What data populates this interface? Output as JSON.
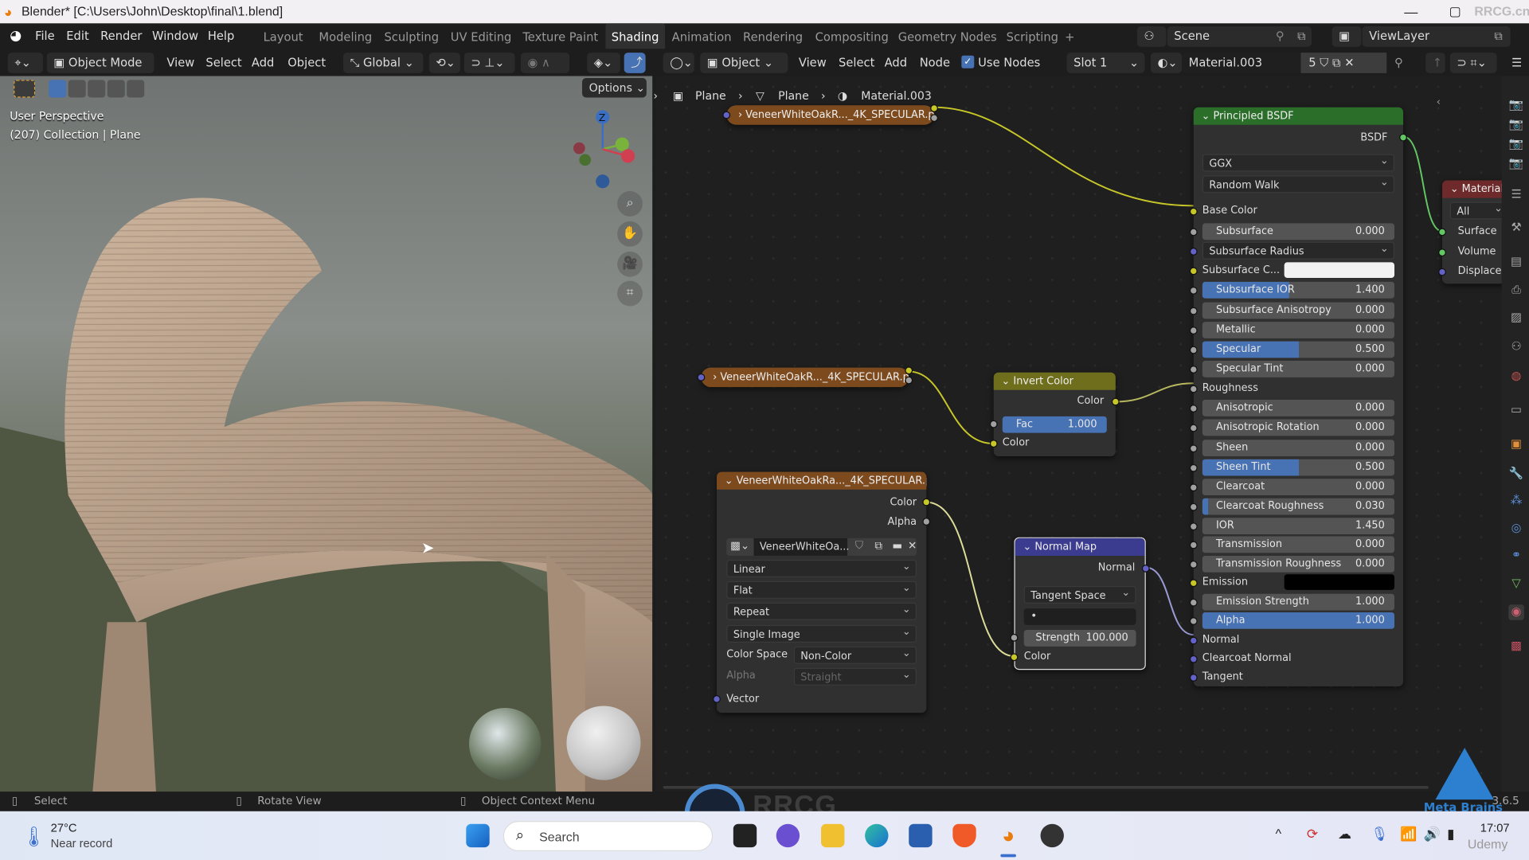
{
  "window": {
    "title": "Blender* [C:\\Users\\John\\Desktop\\final\\1.blend]",
    "watermark": "RRCG.cn"
  },
  "menu": [
    "File",
    "Edit",
    "Render",
    "Window",
    "Help"
  ],
  "workspaces": [
    "Layout",
    "Modeling",
    "Sculpting",
    "UV Editing",
    "Texture Paint",
    "Shading",
    "Animation",
    "Rendering",
    "Compositing",
    "Geometry Nodes",
    "Scripting",
    "+"
  ],
  "active_workspace": "Shading",
  "scene": {
    "name": "Scene",
    "view_layer": "ViewLayer"
  },
  "viewport_header": {
    "mode": "Object Mode",
    "items": [
      "View",
      "Select",
      "Add",
      "Object"
    ],
    "transform": "Global",
    "options": "Options"
  },
  "viewport": {
    "perspective": "User Perspective",
    "collection": "(207) Collection | Plane",
    "axes": {
      "z": "Z",
      "y": "Y",
      "x": "X"
    }
  },
  "node_header": {
    "type": "Object",
    "items": [
      "View",
      "Select",
      "Add",
      "Node"
    ],
    "use_nodes": "Use Nodes",
    "use_nodes_checked": true,
    "slot": "Slot 1",
    "material": "Material.003",
    "users": "5"
  },
  "breadcrumb": [
    "Plane",
    "Plane",
    "Material.003"
  ],
  "nodes": {
    "img1": {
      "title": "VeneerWhiteOakR..._4K_SPECULAR.png"
    },
    "img2": {
      "title": "VeneerWhiteOakR..._4K_SPECULAR.png"
    },
    "img3": {
      "title": "VeneerWhiteOakRa..._4K_SPECULAR.png",
      "out_color": "Color",
      "out_alpha": "Alpha",
      "image_name": "VeneerWhiteOa...",
      "interpolation": "Linear",
      "projection": "Flat",
      "extension": "Repeat",
      "source": "Single Image",
      "color_space_label": "Color Space",
      "color_space": "Non-Color",
      "alpha_label": "Alpha",
      "alpha": "Straight",
      "in_vector": "Vector"
    },
    "invert": {
      "title": "Invert Color",
      "out": "Color",
      "fac_label": "Fac",
      "fac": "1.000",
      "fac_fill": 1.0,
      "in": "Color"
    },
    "normalmap": {
      "title": "Normal Map",
      "out": "Normal",
      "space": "Tangent Space",
      "uv": "•",
      "strength_label": "Strength",
      "strength": "100.000",
      "in": "Color"
    },
    "principled": {
      "title": "Principled BSDF",
      "out": "BSDF",
      "distribution": "GGX",
      "sss_method": "Random Walk",
      "rows": [
        {
          "label": "Base Color",
          "kind": "socket",
          "sock": "#c7c729"
        },
        {
          "label": "Subsurface",
          "kind": "num",
          "value": "0.000",
          "fill": 0,
          "sock": "#a1a1a1"
        },
        {
          "label": "Subsurface Radius",
          "kind": "dropdown",
          "sock": "#6363c7"
        },
        {
          "label": "Subsurface C...",
          "kind": "color",
          "color": "#f2f2f2",
          "sock": "#c7c729"
        },
        {
          "label": "Subsurface IOR",
          "kind": "num",
          "value": "1.400",
          "fill": 0.45,
          "sock": "#a1a1a1"
        },
        {
          "label": "Subsurface Anisotropy",
          "kind": "num",
          "value": "0.000",
          "fill": 0,
          "sock": "#a1a1a1"
        },
        {
          "label": "Metallic",
          "kind": "num",
          "value": "0.000",
          "fill": 0,
          "sock": "#a1a1a1"
        },
        {
          "label": "Specular",
          "kind": "num",
          "value": "0.500",
          "fill": 0.5,
          "sock": "#a1a1a1"
        },
        {
          "label": "Specular Tint",
          "kind": "num",
          "value": "0.000",
          "fill": 0,
          "sock": "#a1a1a1"
        },
        {
          "label": "Roughness",
          "kind": "socket",
          "sock": "#a1a1a1"
        },
        {
          "label": "Anisotropic",
          "kind": "num",
          "value": "0.000",
          "fill": 0,
          "sock": "#a1a1a1"
        },
        {
          "label": "Anisotropic Rotation",
          "kind": "num",
          "value": "0.000",
          "fill": 0,
          "sock": "#a1a1a1"
        },
        {
          "label": "Sheen",
          "kind": "num",
          "value": "0.000",
          "fill": 0,
          "sock": "#a1a1a1"
        },
        {
          "label": "Sheen Tint",
          "kind": "num",
          "value": "0.500",
          "fill": 0.5,
          "sock": "#a1a1a1"
        },
        {
          "label": "Clearcoat",
          "kind": "num",
          "value": "0.000",
          "fill": 0,
          "sock": "#a1a1a1"
        },
        {
          "label": "Clearcoat Roughness",
          "kind": "num",
          "value": "0.030",
          "fill": 0.03,
          "sock": "#a1a1a1"
        },
        {
          "label": "IOR",
          "kind": "num",
          "value": "1.450",
          "fill": 0,
          "sock": "#a1a1a1"
        },
        {
          "label": "Transmission",
          "kind": "num",
          "value": "0.000",
          "fill": 0,
          "sock": "#a1a1a1"
        },
        {
          "label": "Transmission Roughness",
          "kind": "num",
          "value": "0.000",
          "fill": 0,
          "sock": "#a1a1a1"
        },
        {
          "label": "Emission",
          "kind": "color",
          "color": "#000000",
          "sock": "#c7c729"
        },
        {
          "label": "Emission Strength",
          "kind": "num",
          "value": "1.000",
          "fill": 0,
          "sock": "#a1a1a1"
        },
        {
          "label": "Alpha",
          "kind": "num",
          "value": "1.000",
          "fill": 1,
          "sock": "#a1a1a1"
        },
        {
          "label": "Normal",
          "kind": "socket",
          "sock": "#6363c7"
        },
        {
          "label": "Clearcoat Normal",
          "kind": "socket",
          "sock": "#6363c7"
        },
        {
          "label": "Tangent",
          "kind": "socket",
          "sock": "#6363c7"
        }
      ]
    },
    "output": {
      "title": "Material",
      "target": "All",
      "inputs": [
        "Surface",
        "Volume",
        "Displacement"
      ]
    }
  },
  "statusbar": {
    "select": "Select",
    "rotate": "Rotate View",
    "context": "Object Context Menu",
    "version": "3.6.5"
  },
  "taskbar": {
    "temp": "27°C",
    "weather": "Near record",
    "search": "Search",
    "time": "17:07",
    "overlay_brand": "Meta Brains",
    "overlay_udemy": "Udemy"
  },
  "colors": {
    "accent": "#4772b3",
    "image_node": "#7d4a1e",
    "invert_node": "#6e6e1d",
    "normal_node": "#3b3b8f",
    "bsdf_node": "#2a6e2a",
    "output_node": "#6e2a2a",
    "link_color": "#c7c729",
    "link_vector": "#6363c7",
    "link_shader": "#63c763"
  }
}
